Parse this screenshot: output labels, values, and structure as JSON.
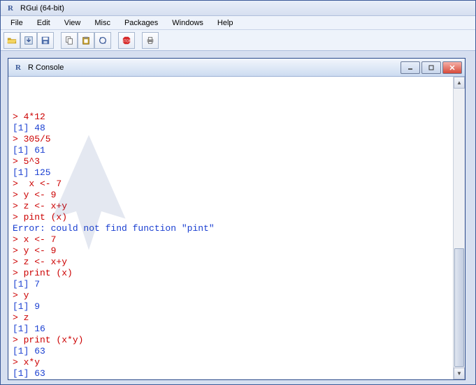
{
  "app": {
    "title": "RGui (64-bit)"
  },
  "menu": {
    "items": [
      "File",
      "Edit",
      "View",
      "Misc",
      "Packages",
      "Windows",
      "Help"
    ]
  },
  "toolbar": {
    "buttons": [
      {
        "name": "open-icon"
      },
      {
        "name": "load-workspace-icon"
      },
      {
        "name": "save-icon"
      },
      {
        "name": "copy-icon"
      },
      {
        "name": "paste-icon"
      },
      {
        "name": "copy-paste-icon"
      },
      {
        "name": "stop-icon"
      },
      {
        "name": "print-icon"
      }
    ]
  },
  "console": {
    "title": "R Console",
    "lines": [
      {
        "c": "red",
        "t": "> 4*12"
      },
      {
        "c": "blue",
        "t": "[1] 48"
      },
      {
        "c": "red",
        "t": "> 305/5"
      },
      {
        "c": "blue",
        "t": "[1] 61"
      },
      {
        "c": "red",
        "t": "> 5^3"
      },
      {
        "c": "blue",
        "t": "[1] 125"
      },
      {
        "c": "red",
        "t": ">  x <- 7"
      },
      {
        "c": "red",
        "t": "> y <- 9"
      },
      {
        "c": "red",
        "t": "> z <- x+y"
      },
      {
        "c": "red",
        "t": "> pint (x)"
      },
      {
        "c": "blue",
        "t": "Error: could not find function \"pint\""
      },
      {
        "c": "red",
        "t": "> x <- 7"
      },
      {
        "c": "red",
        "t": "> y <- 9"
      },
      {
        "c": "red",
        "t": "> z <- x+y"
      },
      {
        "c": "red",
        "t": "> print (x)"
      },
      {
        "c": "blue",
        "t": "[1] 7"
      },
      {
        "c": "red",
        "t": "> y"
      },
      {
        "c": "blue",
        "t": "[1] 9"
      },
      {
        "c": "red",
        "t": "> z"
      },
      {
        "c": "blue",
        "t": "[1] 16"
      },
      {
        "c": "red",
        "t": "> print (x*y)"
      },
      {
        "c": "blue",
        "t": "[1] 63"
      },
      {
        "c": "red",
        "t": "> x*y"
      },
      {
        "c": "blue",
        "t": "[1] 63"
      }
    ],
    "prompt": "> "
  }
}
